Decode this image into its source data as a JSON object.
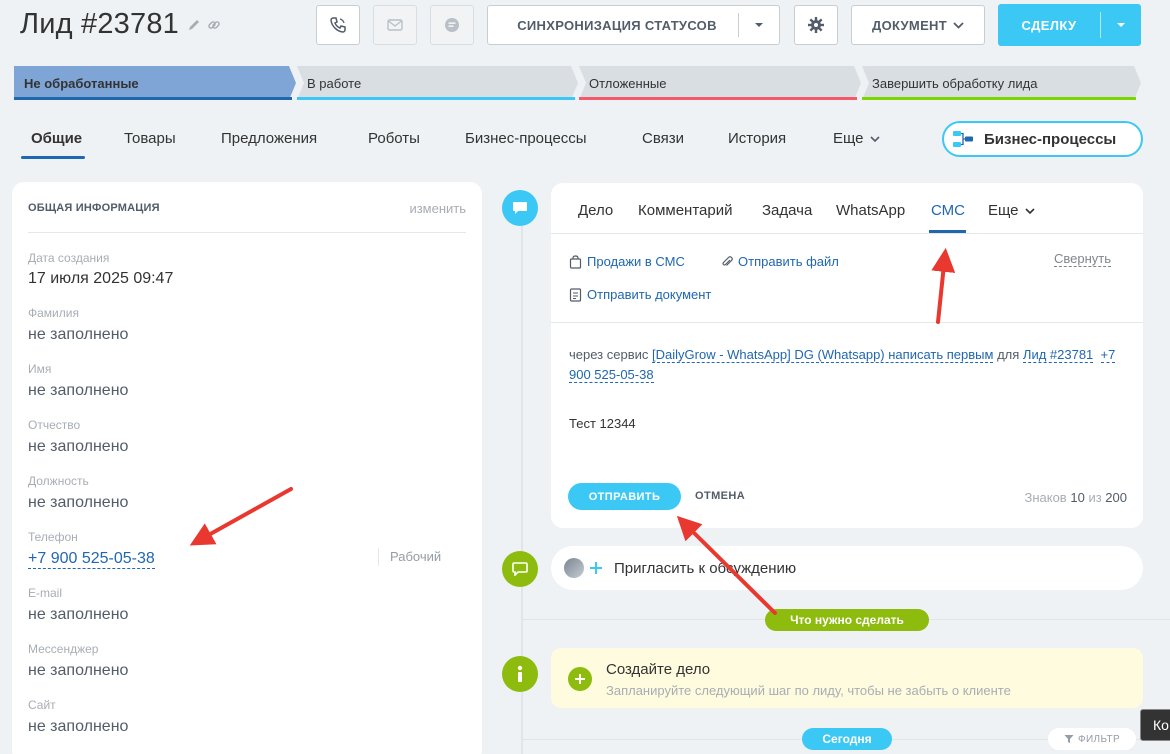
{
  "header": {
    "title": "Лид #23781",
    "sync_label": "СИНХРОНИЗАЦИЯ СТАТУСОВ",
    "doc_label": "ДОКУМЕНТ",
    "deal_label": "СДЕЛКУ",
    "icons": [
      "pencil-icon",
      "link-icon",
      "phone-icon",
      "mail-icon",
      "chat-icon",
      "gear-icon"
    ]
  },
  "stages": [
    {
      "label": "Не обработанные",
      "bar": "#2067b0",
      "fill": "#7ea5d6"
    },
    {
      "label": "В работе",
      "bar": "#3bc8f5",
      "fill": "#d9dee3"
    },
    {
      "label": "Отложенные",
      "bar": "#f25a6b",
      "fill": "#d9dee3"
    },
    {
      "label": "Завершить обработку лида",
      "bar": "#7bd500",
      "fill": "#d9dee3"
    }
  ],
  "tabs": [
    "Общие",
    "Товары",
    "Предложения",
    "Роботы",
    "Бизнес-процессы",
    "Связи",
    "История",
    "Еще"
  ],
  "bp_button": "Бизнес-процессы",
  "left": {
    "heading": "ОБЩАЯ ИНФОРМАЦИЯ",
    "edit": "изменить",
    "fields": [
      {
        "label": "Дата создания",
        "value": "17 июля 2025 09:47"
      },
      {
        "label": "Фамилия",
        "value": "не заполнено"
      },
      {
        "label": "Имя",
        "value": "не заполнено"
      },
      {
        "label": "Отчество",
        "value": "не заполнено"
      },
      {
        "label": "Должность",
        "value": "не заполнено"
      },
      {
        "label": "Телефон",
        "value": "+7 900 525-05-38",
        "type": "Рабочий"
      },
      {
        "label": "E-mail",
        "value": "не заполнено"
      },
      {
        "label": "Мессенджер",
        "value": "не заполнено"
      },
      {
        "label": "Сайт",
        "value": "не заполнено"
      }
    ]
  },
  "composer": {
    "tabs": [
      "Дело",
      "Комментарий",
      "Задача",
      "WhatsApp",
      "СМС",
      "Еще"
    ],
    "active_tab": "СМС",
    "link_sales": "Продажи в СМС",
    "link_file": "Отправить файл",
    "link_doc": "Отправить документ",
    "collapse": "Свернуть",
    "via_prefix": "через сервис",
    "via_service": "[DailyGrow - WhatsApp] DG (Whatsapp) написать первым",
    "via_for": "для",
    "via_lead": "Лид #23781",
    "via_phone": "+7 900 525-05-38",
    "message": "Тест 12344",
    "send": "ОТПРАВИТЬ",
    "cancel": "ОТМЕНА",
    "chars_label": "Знаков",
    "chars_count": "10",
    "chars_of": "из",
    "chars_max": "200"
  },
  "invite": "Пригласить к обсуждению",
  "todo_pill": "Что нужно сделать",
  "todo": {
    "title": "Создайте дело",
    "subtitle": "Запланируйте следующий шаг по лиду, чтобы не забыть о клиенте"
  },
  "today_pill": "Сегодня",
  "filter": "ФИЛЬТР",
  "tooltip_fragment": "Ко",
  "colors": {
    "accent": "#3bc8f5",
    "link": "#2067b0",
    "green": "#8dbb0e",
    "arrow": "#e8382f"
  }
}
